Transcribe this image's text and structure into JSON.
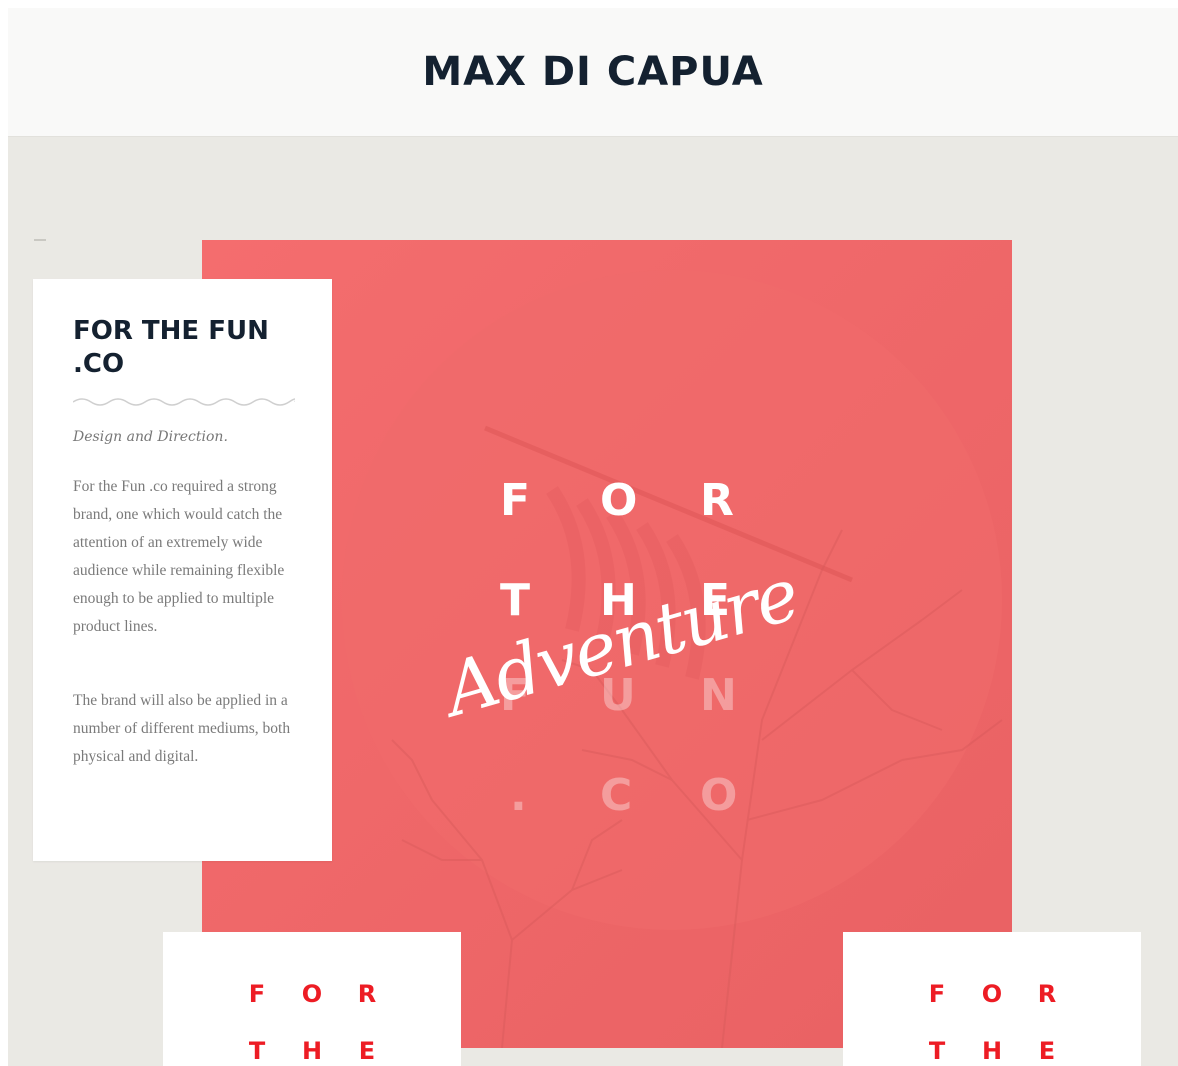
{
  "header": {
    "title": "MAX DI CAPUA"
  },
  "project": {
    "title_line1": "FOR THE FUN",
    "title_line2": ".CO",
    "subtitle": "Design and Direction.",
    "paragraph1": "For the Fun .co required a strong brand, one which would catch the attention of an extremely wide audience while remaining flexible enough to be applied to multiple product lines.",
    "paragraph2": "The brand will also be applied in a number of different mediums, both physical and digital."
  },
  "hero": {
    "row1": [
      "F",
      "O",
      "R"
    ],
    "row2": [
      "T",
      "H",
      "E"
    ],
    "row3": [
      "F",
      "U",
      "N"
    ],
    "row4": [
      ".",
      "C",
      "O"
    ],
    "script": "Adventure",
    "color": "#f26b6c"
  },
  "thumbnails": [
    {
      "row1": [
        "F",
        "O",
        "R"
      ],
      "row2": [
        "T",
        "H",
        "E"
      ],
      "color": "#ed1c24"
    },
    {
      "row1": [
        "F",
        "O",
        "R"
      ],
      "row2": [
        "T",
        "H",
        "E"
      ],
      "color": "#ed1c24"
    }
  ],
  "colors": {
    "title": "#142130",
    "content_bg": "#eae9e4",
    "header_bg": "#f9f9f8"
  }
}
